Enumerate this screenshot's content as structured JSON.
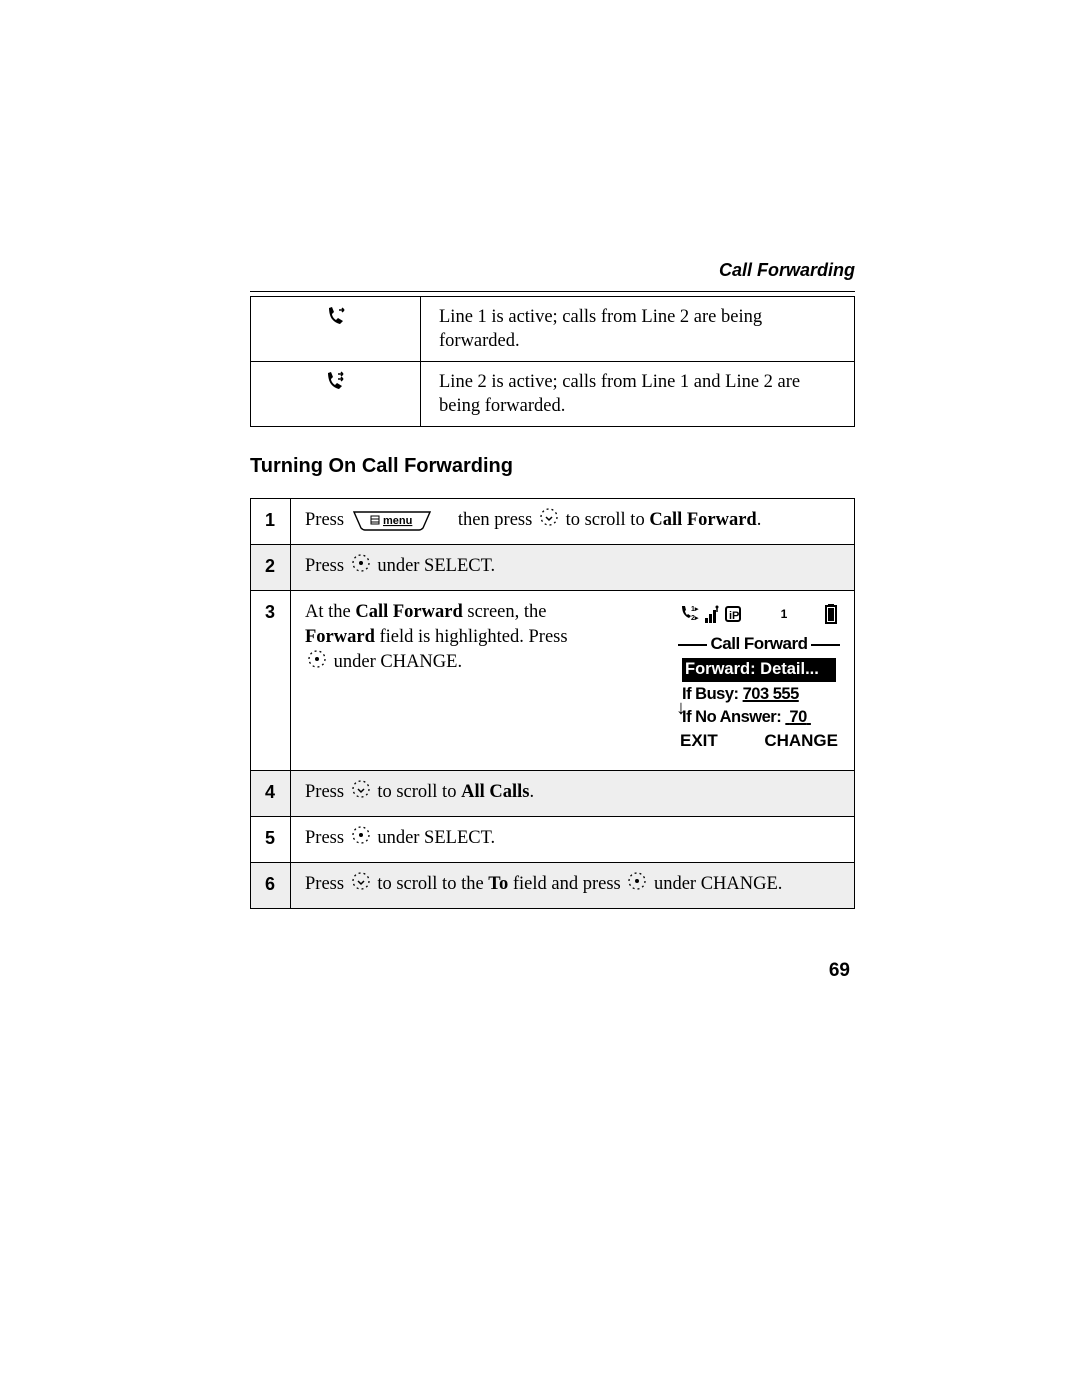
{
  "header": {
    "section": "Call Forwarding"
  },
  "icon_table": [
    {
      "desc": "Line 1 is active; calls from Line 2 are being forwarded."
    },
    {
      "desc": "Line 2 is active; calls from Line 1 and Line 2 are being forwarded."
    }
  ],
  "heading": "Turning On Call Forwarding",
  "steps": {
    "s1": {
      "a": "Press",
      "menu_label": "menu",
      "b": "then press",
      "c": "to scroll to",
      "target": "Call Forward",
      "end": "."
    },
    "s2": {
      "a": "Press",
      "b": "under SELECT."
    },
    "s3": {
      "a": "At the",
      "scr": "Call Forward",
      "b": "screen, the",
      "fld": "Forward",
      "c": "field is highlighted. Press",
      "d": "under CHANGE."
    },
    "s4": {
      "a": "Press",
      "b": "to scroll to",
      "target": "All Calls",
      "end": "."
    },
    "s5": {
      "a": "Press",
      "b": "under SELECT."
    },
    "s6": {
      "a": "Press",
      "b": "to scroll to the",
      "fld": "To",
      "c": "field and press",
      "d": "under CHANGE."
    }
  },
  "phone": {
    "status_one": "1",
    "title": "Call Forward",
    "hl": "Forward: Detail...",
    "busy_label": "If Busy:",
    "busy_val": "703 555",
    "noans_label": "If No Answer:",
    "noans_val": "70",
    "sk_left": "EXIT",
    "sk_right": "CHANGE"
  },
  "page_number": "69"
}
